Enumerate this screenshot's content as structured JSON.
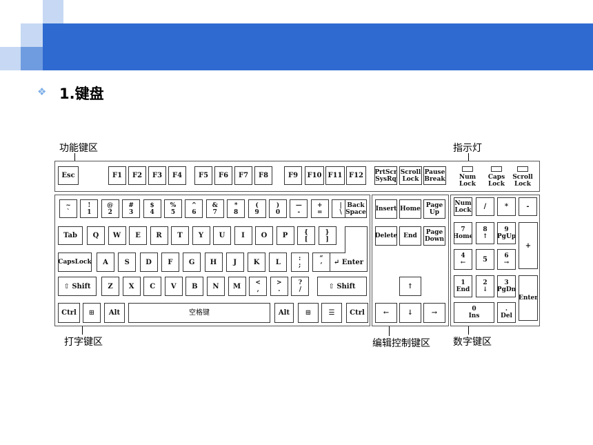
{
  "slide": {
    "bullet_symbol": "❖",
    "title": "1.键盘"
  },
  "labels": {
    "function_zone": "功能键区",
    "indicator_zone": "指示灯",
    "typing_zone": "打字键区",
    "editing_zone": "编辑控制键区",
    "numpad_zone": "数字键区"
  },
  "indicators": [
    {
      "label": "Num\nLock"
    },
    {
      "label": "Caps\nLock"
    },
    {
      "label": "Scroll\nLock"
    }
  ],
  "keys": {
    "function_row": [
      "Esc",
      "F1",
      "F2",
      "F3",
      "F4",
      "F5",
      "F6",
      "F7",
      "F8",
      "F9",
      "F10",
      "F11",
      "F12"
    ],
    "system_keys": [
      "PrtScr\nSysRq",
      "Scroll\nLock",
      "Pause\nBreak"
    ],
    "number_row": [
      "~\n`",
      "!\n1",
      "@\n2",
      "#\n3",
      "$\n4",
      "%\n5",
      "^\n6",
      "&\n7",
      "*\n8",
      "(\n9",
      ")\n0",
      "—\n-",
      "+\n=",
      "|\n\\",
      "Back\nSpace"
    ],
    "top_row": [
      "Tab",
      "Q",
      "W",
      "E",
      "R",
      "T",
      "Y",
      "U",
      "I",
      "O",
      "P",
      "{\n[",
      "}\n]"
    ],
    "home_row": [
      "CapsLock",
      "A",
      "S",
      "D",
      "F",
      "G",
      "H",
      "J",
      "K",
      "L",
      ":\n;",
      "“\n‘",
      "↵ Enter"
    ],
    "bottom_row": [
      "⇧ Shift",
      "Z",
      "X",
      "C",
      "V",
      "B",
      "N",
      "M",
      "<\n,",
      ">\n.",
      "?\n/",
      "⇧ Shift"
    ],
    "space_row": [
      "Ctrl",
      "⊞",
      "Alt",
      "空格键",
      "Alt",
      "⊞",
      "☰",
      "Ctrl"
    ],
    "edit_keys": [
      "Insert",
      "Home",
      "Page\nUp",
      "Delete",
      "End",
      "Page\nDown"
    ],
    "arrow_keys": [
      "↑",
      "←",
      "↓",
      "→"
    ],
    "numpad": [
      "Num\nLock",
      "/",
      "*",
      "-",
      "7\nHome",
      "8\n↑",
      "9\nPgUp",
      "+",
      "4\n←",
      "5",
      "6\n→",
      "1\nEnd",
      "2\n↓",
      "3\nPgDn",
      "Enter",
      "0\nIns",
      ".\nDel"
    ]
  },
  "colors": {
    "banner_blue": "#2f6ad0",
    "light_square": "#c6d8f3",
    "mid_square": "#6f9ce0",
    "bullet": "#7fb0e8"
  }
}
